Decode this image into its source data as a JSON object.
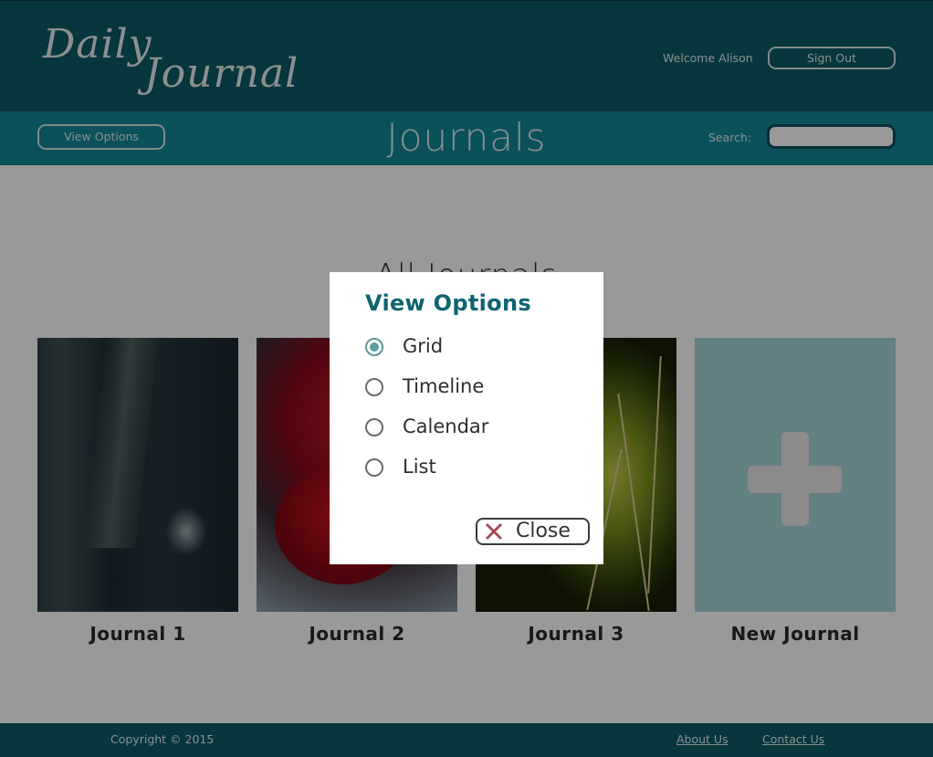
{
  "header": {
    "logo_line1": "Daily",
    "logo_line2": "Journal",
    "welcome": "Welcome Alison",
    "sign_out": "Sign Out"
  },
  "subbar": {
    "view_options": "View Options",
    "title": "Journals",
    "search_label": "Search:",
    "search_value": ""
  },
  "main": {
    "section_title": "All Journals",
    "cards": [
      {
        "caption": "Journal 1"
      },
      {
        "caption": "Journal 2"
      },
      {
        "caption": "Journal 3"
      },
      {
        "caption": "New Journal"
      }
    ]
  },
  "footer": {
    "copyright": "Copyright © 2015",
    "about": "About Us",
    "contact": "Contact Us"
  },
  "modal": {
    "title": "View Options",
    "options": [
      {
        "label": "Grid",
        "selected": true
      },
      {
        "label": "Timeline",
        "selected": false
      },
      {
        "label": "Calendar",
        "selected": false
      },
      {
        "label": "List",
        "selected": false
      }
    ],
    "close": "Close"
  },
  "colors": {
    "header_bg": "#0c5a66",
    "subbar_bg": "#128895",
    "accent_title": "#0e6470",
    "radio_selected": "#5c9fa0",
    "close_icon": "#a34a54"
  }
}
